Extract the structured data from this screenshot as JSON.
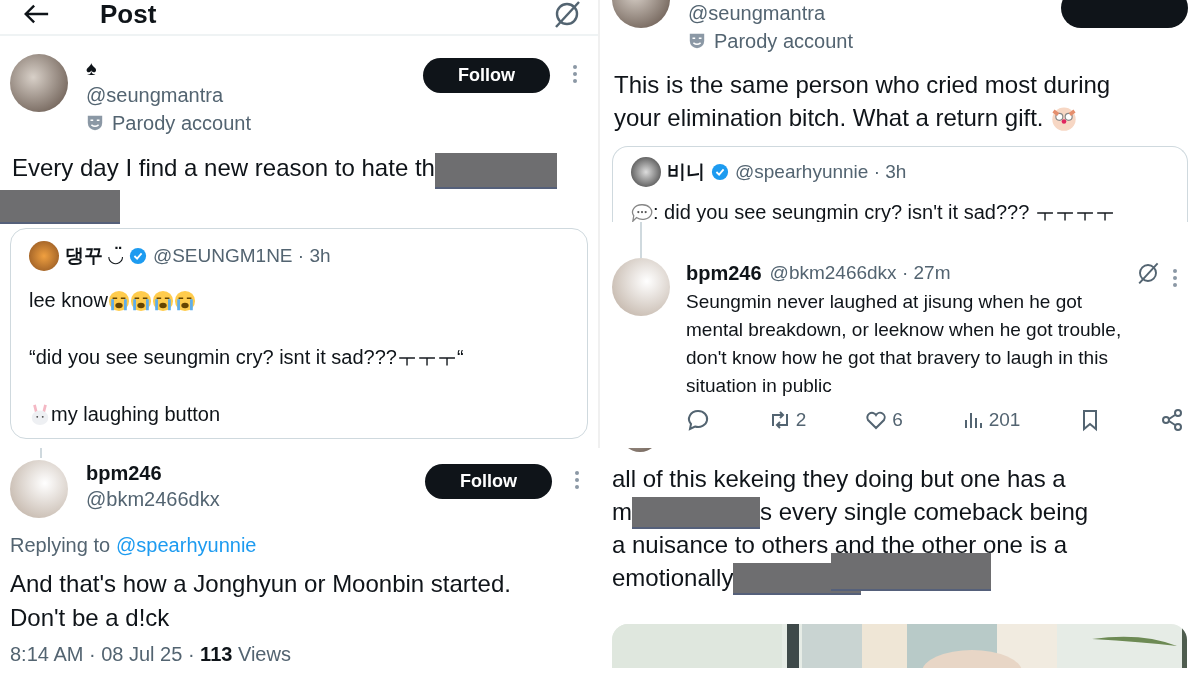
{
  "header": {
    "title": "Post"
  },
  "main_post": {
    "name": "♠",
    "handle": "@seungmantra",
    "badge": "Parody account",
    "follow": "Follow",
    "text": [
      {
        "kind": "text",
        "text": "Every day I find a new reason to hate th"
      },
      {
        "kind": "redacted"
      },
      {
        "kind": "break"
      },
      {
        "kind": "redacted"
      }
    ],
    "quote": {
      "name": "댕꾸 ◡̈",
      "handle": "@SEUNGM1NE · 3h",
      "lines": [
        {
          "kind": "crying",
          "text": "lee know"
        },
        {
          "kind": "plain",
          "text": "“did you see seungmin cry? isnt it sad???ㅜㅜㅜ“"
        },
        {
          "kind": "rabbit",
          "text": "my laughing button"
        }
      ]
    }
  },
  "second_post": {
    "handle": "@seungmantra",
    "badge": "Parody account",
    "lines": [
      "This is the same person who cried most during",
      "your elimination bitch. What a return gift."
    ],
    "quote": {
      "name": "비니",
      "handle": "@spearhyunnie · 3h",
      "text": ": did you see seungmin cry? isn't it sad??? ㅜㅜㅜㅜ"
    }
  },
  "reply": {
    "name": "bpm246",
    "handle": "@bkm2466dkx · 27m",
    "lines": [
      "Seungmin never laughed at jisung when he got",
      "mental breakdown, or leeknow when he got trouble,",
      "don't know how he got that bravery to laugh in this",
      "situation in public"
    ],
    "actions": [
      {
        "kind": "reply"
      },
      {
        "kind": "repost",
        "count": "2"
      },
      {
        "kind": "like",
        "count": "6"
      },
      {
        "kind": "views",
        "count": "201"
      },
      {
        "kind": "bookmark"
      },
      {
        "kind": "share"
      }
    ]
  },
  "reply_detail": {
    "name": "bpm246",
    "handle": "@bkm2466dkx",
    "follow": "Follow",
    "replying_to": "Replying to",
    "replying_handle": "@spearhyunnie",
    "lines": [
      "And that's how a Jonghyun or Moonbin started.",
      "Don't be a d!ck"
    ],
    "meta": "8:14 AM · 08 Jul 25 · **113** Views"
  },
  "comment": {
    "lines": [
      [
        {
          "kind": "text",
          "text": "all of this kekeing they doing but one has a"
        }
      ],
      [
        {
          "kind": "text",
          "text": "m"
        },
        {
          "kind": "redacted"
        },
        {
          "kind": "text",
          "text": "s every single comeback being"
        }
      ],
      [
        {
          "kind": "text",
          "text": "a nuisance to others and the other one is a"
        }
      ],
      [
        {
          "kind": "text",
          "text": "emotionally"
        },
        {
          "kind": "redacted"
        },
        {
          "kind": "redacted"
        }
      ]
    ]
  }
}
